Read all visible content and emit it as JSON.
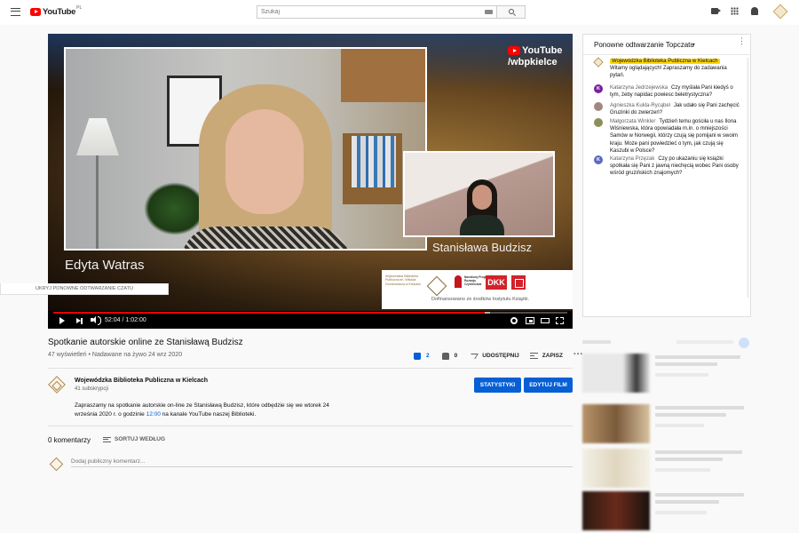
{
  "header": {
    "logo_text": "YouTube",
    "logo_country": "PL",
    "search_placeholder": "Szukaj"
  },
  "player": {
    "main_speaker_name": "Edyta Watras",
    "pip_speaker_name": "Stanisława Budzisz",
    "brand_name": "YouTube",
    "brand_handle": "/wbpkielce",
    "sponsor_caption": "Dofinansowano ze środków Instytutu Książki.",
    "sponsor_logo1": "Wojewódzka Biblioteka Publiczna im. Witolda Gombrowicza w Kielcach",
    "sponsor_logo2": "Narodowy Program Rozwoju Czytelnictwa",
    "sponsor_logo3": "DKK",
    "time_current": "52:04",
    "time_separator": " / ",
    "time_total": "1:02:00",
    "progress_fraction": 0.84,
    "buffer_fraction": 0.85
  },
  "video": {
    "title": "Spotkanie autorskie online ze Stanisławą Budzisz",
    "meta": "47 wyświetleń • Nadawane na żywo 24 wrz 2020",
    "likes": "2",
    "dislikes": "0",
    "share_label": "UDOSTĘPNIJ",
    "save_label": "ZAPISZ",
    "more_label": "···"
  },
  "channel": {
    "name": "Wojewódzka Biblioteka Publiczna w Kielcach",
    "subs": "41 subskrypcji",
    "stats_button": "STATYSTYKI",
    "edit_button": "EDYTUJ FILM",
    "desc_part1": "Zapraszamy na spotkanie autorskie on-line ze Stanisławą Budzisz, które odbędzie się we wtorek 24 września 2020 r. o godzinie ",
    "desc_link": "12:00",
    "desc_part2": " na kanale YouTube naszej Biblioteki."
  },
  "comments": {
    "count_label": "0 komentarzy",
    "sort_label": "SORTUJ WEDŁUG",
    "input_placeholder": "Dodaj publiczny komentarz..."
  },
  "chat": {
    "title": "Ponowne odtwarzanie Topczatu",
    "more_label": "⋮",
    "hide_label": "UKRYJ PONOWNE ODTWARZANIE CZATU",
    "messages": [
      {
        "author": "Wojewódzka Biblioteka Publiczna w Kielcach",
        "text": "Witamy oglądających! Zapraszamy do zadawania pytań.",
        "initial": "",
        "color": "#f4e7cc"
      },
      {
        "author": "Katarzyna Jedrzejewska",
        "text": "Czy myślała Pani kiedyś o tym, żeby napidac powiesc beletrystyczna?",
        "initial": "K",
        "color": "#7b1fa2"
      },
      {
        "author": "Agnieszka Kukla-Rycąbel",
        "text": "Jak udało się Pani zachęcić Gruzinki do zwierzeń?",
        "initial": "",
        "color": "#a1887f"
      },
      {
        "author": "Małgorzata Winkler",
        "text": "Tydzień temu gościła u nas Ilona Wiśniewska, która opowiadała m.in. o mniejszości Samów w Norwegii, którzy czują się pomijani w swoim kraju. Może pani powiedzieć o tym, jak czują się Kaszubi w Polsce?",
        "initial": "",
        "color": "#8d8f5a"
      },
      {
        "author": "Katarzyna Przęzak",
        "text": "Czy po ukazaniu się książki spotkała się Pani z jawną niechęcią wobec Pani osoby wśród gruzińskich znajomych?",
        "initial": "K",
        "color": "#5c6bc0"
      }
    ]
  }
}
